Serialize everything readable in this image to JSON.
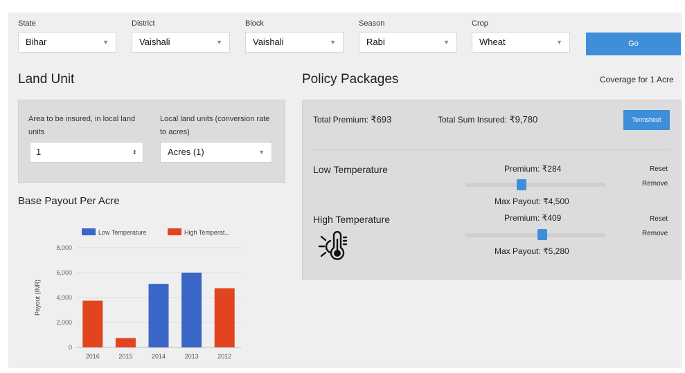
{
  "filters": [
    {
      "label": "State",
      "value": "Bihar"
    },
    {
      "label": "District",
      "value": "Vaishali"
    },
    {
      "label": "Block",
      "value": "Vaishali"
    },
    {
      "label": "Season",
      "value": "Rabi"
    },
    {
      "label": "Crop",
      "value": "Wheat"
    }
  ],
  "go_label": "Go",
  "land_unit": {
    "title": "Land Unit",
    "area_label": "Area to be insured, in local land units",
    "area_value": "1",
    "unit_label": "Local land units (conversion rate to acres)",
    "unit_value": "Acres (1)"
  },
  "policy": {
    "title": "Policy Packages",
    "coverage": "Coverage for 1 Acre",
    "total_premium_label": "Total Premium:",
    "total_premium_value": "₹693",
    "total_sum_label": "Total Sum Insured:",
    "total_sum_value": "₹9,780",
    "termsheet_label": "Termsheet",
    "packages": [
      {
        "name": "Low Temperature",
        "premium": "Premium: ₹284",
        "max_payout": "Max Payout: ₹4,500",
        "reset": "Reset",
        "remove": "Remove",
        "slider_level": 0.4
      },
      {
        "name": "High Temperature",
        "premium": "Premium: ₹409",
        "max_payout": "Max Payout: ₹5,280",
        "reset": "Reset",
        "remove": "Remove",
        "slider_level": 0.55
      }
    ]
  },
  "base_payout_title": "Base Payout Per Acre",
  "chart_data": {
    "type": "bar",
    "categories": [
      "2016",
      "2015",
      "2014",
      "2013",
      "2012"
    ],
    "series": [
      {
        "name": "Low Temperature",
        "color": "#3a67c6",
        "values": [
          0,
          0,
          5100,
          6000,
          0
        ]
      },
      {
        "name": "High Temperat...",
        "color": "#e24420",
        "values": [
          3750,
          750,
          0,
          0,
          4750
        ]
      }
    ],
    "ylabel": "Payout (INR)",
    "ylim": [
      0,
      8000
    ],
    "yticks": [
      "0",
      "2,000",
      "4,000",
      "6,000",
      "8,000"
    ],
    "legend_position": "top"
  }
}
